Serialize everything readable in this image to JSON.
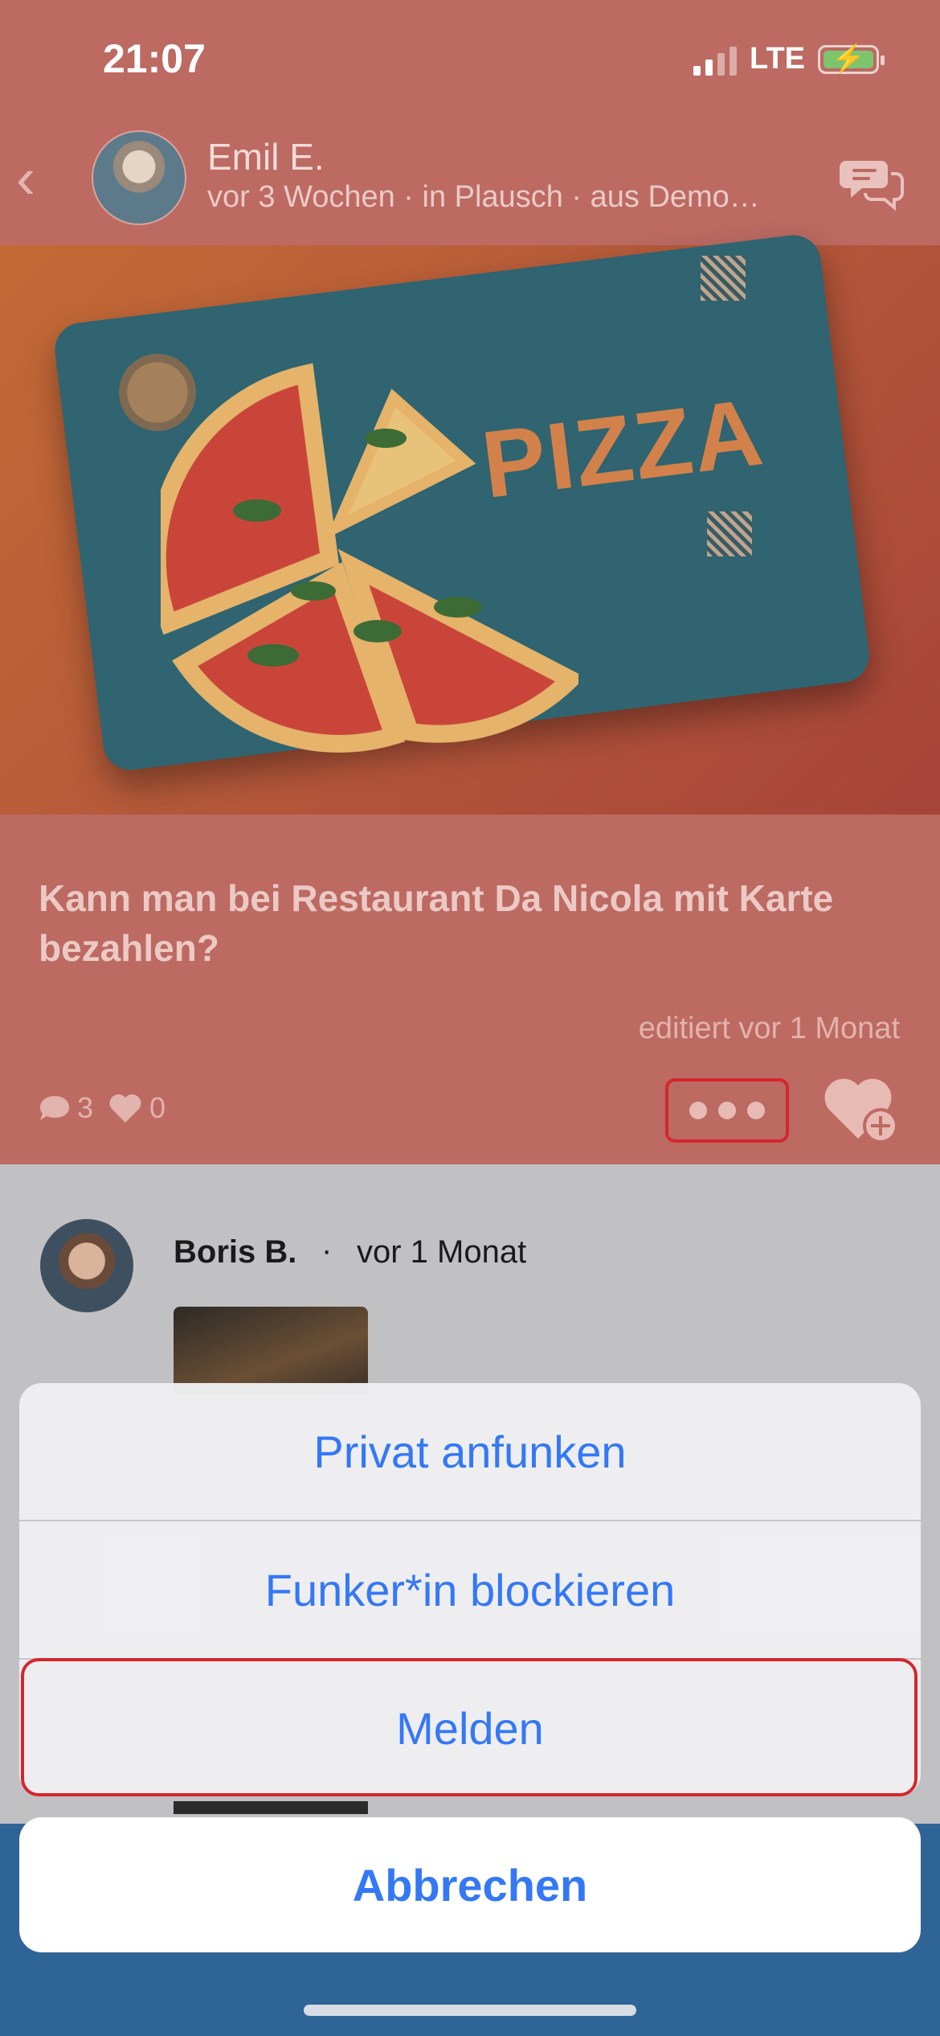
{
  "status_bar": {
    "time": "21:07",
    "network": "LTE"
  },
  "header": {
    "author_name": "Emil E.",
    "meta": "vor 3 Wochen · in Plausch · aus Demo…"
  },
  "hero_image": {
    "title_text": "PIZZA"
  },
  "post": {
    "question": "Kann man bei Restaurant Da Nicola mit Karte bezahlen?",
    "edited": "editiert vor 1 Monat",
    "comments_count": "3",
    "likes_count": "0"
  },
  "comment": {
    "author": "Boris B.",
    "separator": "·",
    "time": "vor 1 Monat"
  },
  "action_sheet": {
    "items": [
      {
        "label": "Privat anfunken"
      },
      {
        "label": "Funker*in blockieren"
      },
      {
        "label": "Melden"
      }
    ],
    "cancel_label": "Abbrechen"
  },
  "colors": {
    "accent": "#3478f6",
    "header_bg": "#bc6a62",
    "highlight": "#d6262e"
  }
}
